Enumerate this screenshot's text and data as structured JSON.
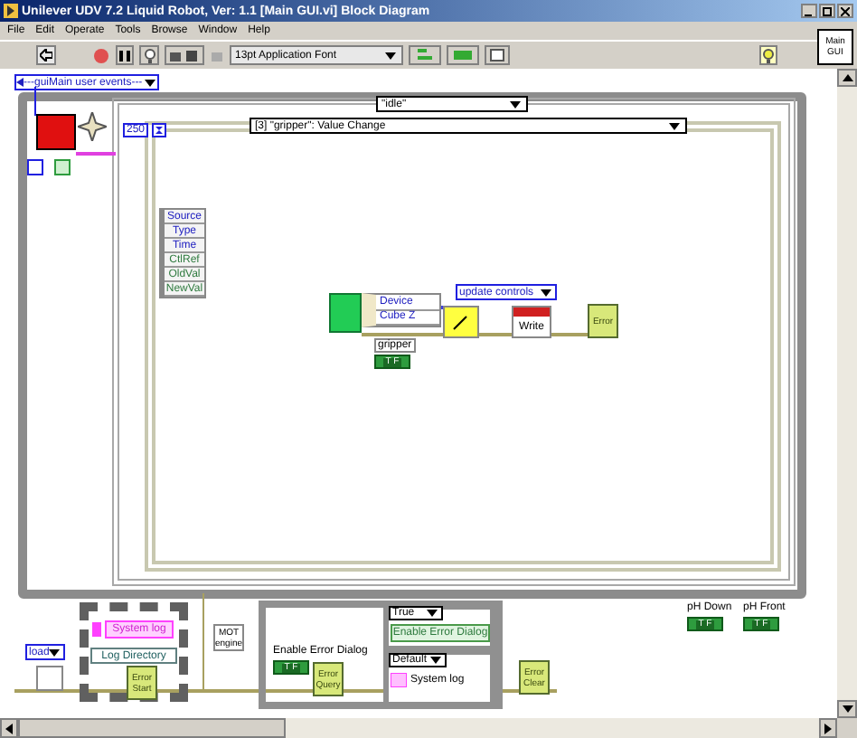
{
  "window": {
    "title": "Unilever UDV 7.2 Liquid Robot, Ver: 1.1 [Main GUI.vi] Block Diagram"
  },
  "menu": [
    "File",
    "Edit",
    "Operate",
    "Tools",
    "Browse",
    "Window",
    "Help"
  ],
  "toolbar": {
    "font_selector": "13pt Application Font"
  },
  "connector_pane": {
    "label": "Main GUI"
  },
  "diagram": {
    "event_enum": "---guiMain user events---",
    "timeout": "250",
    "case_selector": "\"idle\"",
    "event_selector": "[3] \"gripper\": Value Change",
    "event_data": [
      "Source",
      "Type",
      "Time",
      "CtlRef",
      "OldVal",
      "NewVal"
    ],
    "unbundle": [
      "Device",
      "Cube Z"
    ],
    "state_enum": "update controls",
    "write_node": "Write",
    "error_node": "Error",
    "gripper": {
      "label": "gripper",
      "value": "T F"
    },
    "log_enum": "load",
    "system_log": "System log",
    "log_directory": "Log Directory",
    "error_start": "Error Start",
    "mot_engine": "MOT engine",
    "enable_error_dialog": {
      "label": "Enable Error Dialog",
      "value": "T F"
    },
    "error_query": "Error Query",
    "true_selector": "True",
    "enable_error_dialog_constant": "Enable Error Dialog",
    "default_selector": "Default",
    "system_log_text": "System log",
    "error_clear": "Error Clear",
    "ph_down": {
      "label": "pH Down",
      "value": "T F"
    },
    "ph_front": {
      "label": "pH Front",
      "value": "T F"
    }
  }
}
